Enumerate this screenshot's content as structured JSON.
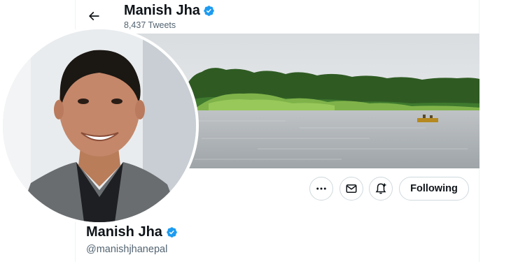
{
  "header": {
    "name": "Manish Jha",
    "tweet_count": "8,437 Tweets",
    "verified": true
  },
  "profile": {
    "name": "Manish Jha",
    "handle": "@manishjhanepal",
    "verified": true
  },
  "actions": {
    "more_icon": "more-dots-icon",
    "message_icon": "envelope-icon",
    "notify_icon": "bell-plus-icon",
    "following_label": "Following"
  },
  "icons": {
    "back": "back-arrow-icon",
    "verified": "verified-badge-icon"
  },
  "colors": {
    "verified_blue": "#1d9bf0",
    "text_primary": "#0f1419",
    "text_secondary": "#536471",
    "border": "#cfd9de"
  }
}
